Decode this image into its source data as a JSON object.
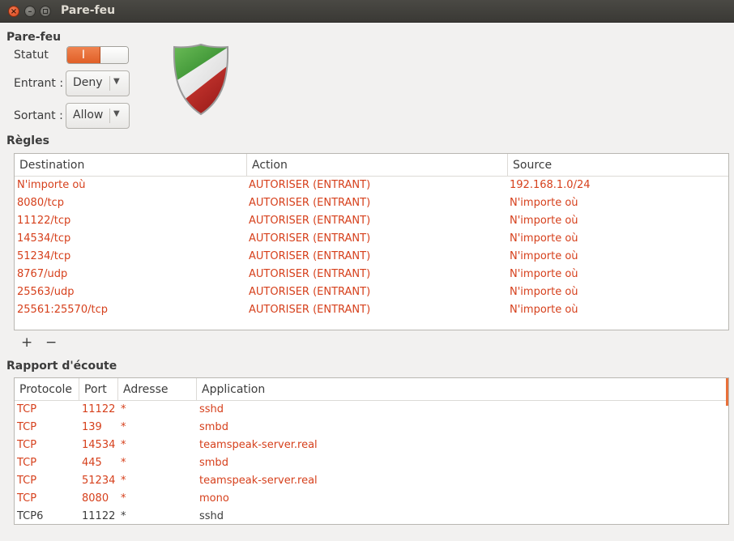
{
  "window": {
    "title": "Pare-feu",
    "close_glyph": "×",
    "minimize_glyph": "–"
  },
  "firewall": {
    "section_label": "Pare-feu",
    "status_label": "Statut",
    "status_toggle_on_glyph": "I",
    "incoming_label": "Entrant :",
    "incoming_value": "Deny",
    "outgoing_label": "Sortant :",
    "outgoing_value": "Allow",
    "toggle_color": "#e8703a"
  },
  "rules": {
    "section_label": "Règles",
    "columns": [
      "Destination",
      "Action",
      "Source"
    ],
    "rows": [
      {
        "destination": "N'importe où",
        "action": "AUTORISER (ENTRANT)",
        "source": "192.168.1.0/24"
      },
      {
        "destination": "8080/tcp",
        "action": "AUTORISER (ENTRANT)",
        "source": "N'importe où"
      },
      {
        "destination": "11122/tcp",
        "action": "AUTORISER (ENTRANT)",
        "source": "N'importe où"
      },
      {
        "destination": "14534/tcp",
        "action": "AUTORISER (ENTRANT)",
        "source": "N'importe où"
      },
      {
        "destination": "51234/tcp",
        "action": "AUTORISER (ENTRANT)",
        "source": "N'importe où"
      },
      {
        "destination": "8767/udp",
        "action": "AUTORISER (ENTRANT)",
        "source": "N'importe où"
      },
      {
        "destination": "25563/udp",
        "action": "AUTORISER (ENTRANT)",
        "source": "N'importe où"
      },
      {
        "destination": "25561:25570/tcp",
        "action": "AUTORISER (ENTRANT)",
        "source": "N'importe où"
      }
    ],
    "add_label": "+",
    "remove_label": "−"
  },
  "report": {
    "section_label": "Rapport d'écoute",
    "columns": [
      "Protocole",
      "Port",
      "Adresse",
      "Application"
    ],
    "rows": [
      {
        "protocol": "TCP",
        "port": "11122",
        "address": "*",
        "application": "sshd",
        "highlight": true
      },
      {
        "protocol": "TCP",
        "port": "139",
        "address": "*",
        "application": "smbd",
        "highlight": true
      },
      {
        "protocol": "TCP",
        "port": "14534",
        "address": "*",
        "application": "teamspeak-server.real",
        "highlight": true
      },
      {
        "protocol": "TCP",
        "port": "445",
        "address": "*",
        "application": "smbd",
        "highlight": true
      },
      {
        "protocol": "TCP",
        "port": "51234",
        "address": "*",
        "application": "teamspeak-server.real",
        "highlight": true
      },
      {
        "protocol": "TCP",
        "port": "8080",
        "address": "*",
        "application": "mono",
        "highlight": true
      },
      {
        "protocol": "TCP6",
        "port": "11122",
        "address": "*",
        "application": "sshd",
        "highlight": false
      }
    ]
  },
  "colors": {
    "rule_text": "#d6401c",
    "normal_text": "#3c3c3c",
    "accent": "#e8703a"
  }
}
